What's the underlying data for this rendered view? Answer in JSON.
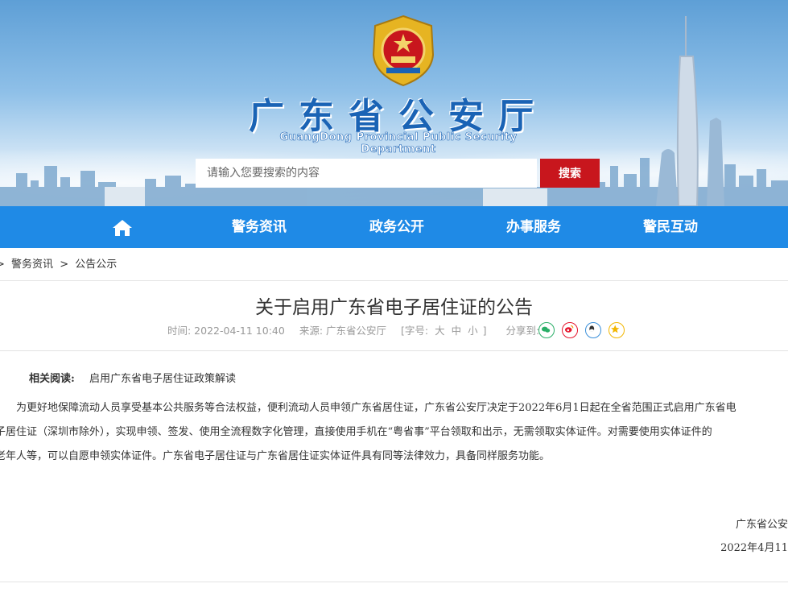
{
  "header": {
    "title_cn": "广东省公安厅",
    "title_en": "GuangDong Provincial Public Security Department",
    "search_placeholder": "请输入您要搜索的内容",
    "search_button": "搜索"
  },
  "nav": {
    "items": [
      {
        "label": "警务资讯"
      },
      {
        "label": "政务公开"
      },
      {
        "label": "办事服务"
      },
      {
        "label": "警民互动"
      }
    ]
  },
  "breadcrumb": {
    "items": [
      "警务资讯",
      "公告公示"
    ],
    "separator": ">"
  },
  "article": {
    "title": "关于启用广东省电子居住证的公告",
    "time": "时间: 2022-04-11 10:40",
    "source": "来源: 广东省公安厅",
    "font_size_label": "[字号:",
    "font_sizes": [
      "大",
      "中",
      "小"
    ],
    "font_size_end": "]",
    "share_label": "分享到:",
    "share_icons": [
      "wechat-icon",
      "weibo-icon",
      "qq-icon",
      "qzone-icon"
    ],
    "related_label": "相关阅读:",
    "related_link": "启用广东省电子居住证政策解读",
    "body_lines": [
      "为更好地保障流动人员享受基本公共服务等合法权益，便利流动人员申领广东省居住证，广东省公安厅决定于2022年6月1日起在全省范围正式启用广东省电",
      "子居住证（深圳市除外），实现申领、签发、使用全流程数字化管理，直接使用手机在“粤省事”平台领取和出示，无需领取实体证件。对需要使用实体证件的",
      "老年人等，可以自愿申领实体证件。广东省电子居住证与广东省居住证实体证件具有同等法律效力，具备同样服务功能。"
    ],
    "signature_org": "广东省公安",
    "signature_date": "2022年4月11"
  },
  "colors": {
    "brand_blue": "#1f8ae6",
    "title_blue": "#1a63b5",
    "search_red": "#c8161d"
  }
}
